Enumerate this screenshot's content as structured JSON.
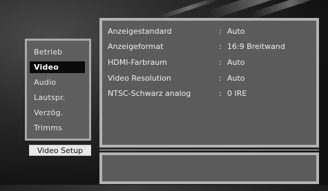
{
  "sidebar": {
    "items": [
      {
        "label": "Betrieb",
        "selected": false
      },
      {
        "label": "Video",
        "selected": true
      },
      {
        "label": "Audio",
        "selected": false
      },
      {
        "label": "Lautspr.",
        "selected": false
      },
      {
        "label": "Verzög.",
        "selected": false
      },
      {
        "label": "Trimms",
        "selected": false
      }
    ],
    "caption": "Video Setup"
  },
  "settings": {
    "rows": [
      {
        "label": "Anzeigestandard",
        "separator": ":",
        "value": "Auto"
      },
      {
        "label": "Anzeigeformat",
        "separator": ":",
        "value": "16:9 Breitwand"
      },
      {
        "label": "HDMI-Farbraum",
        "separator": ":",
        "value": "Auto"
      },
      {
        "label": "Video Resolution",
        "separator": ":",
        "value": "Auto"
      },
      {
        "label": "NTSC-Schwarz analog",
        "separator": ":",
        "value": "0 IRE"
      }
    ]
  },
  "colors": {
    "panel": "#5b5b5b",
    "panel_border": "#b3b3b3",
    "selection": "#0a0a0a",
    "text": "#eeeeee"
  }
}
